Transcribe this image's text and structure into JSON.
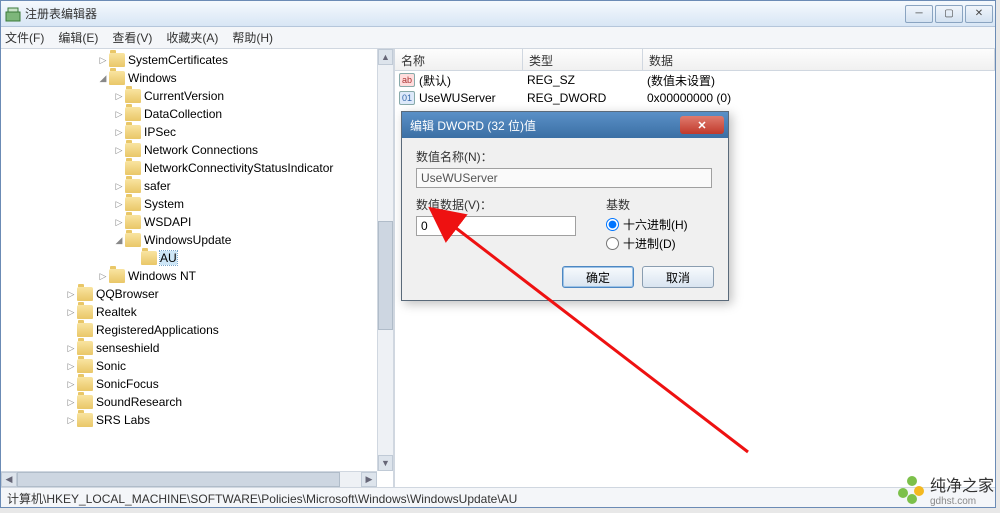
{
  "window": {
    "title": "注册表编辑器"
  },
  "win_controls": {
    "min": "─",
    "max": "▢",
    "close": "✕"
  },
  "menu": {
    "file": "文件(F)",
    "edit": "编辑(E)",
    "view": "查看(V)",
    "fav": "收藏夹(A)",
    "help": "帮助(H)"
  },
  "tree": {
    "items": [
      {
        "indent": 6,
        "tw": "▷",
        "label": "SystemCertificates"
      },
      {
        "indent": 6,
        "tw": "◢",
        "label": "Windows"
      },
      {
        "indent": 7,
        "tw": "▷",
        "label": "CurrentVersion"
      },
      {
        "indent": 7,
        "tw": "▷",
        "label": "DataCollection"
      },
      {
        "indent": 7,
        "tw": "▷",
        "label": "IPSec"
      },
      {
        "indent": 7,
        "tw": "▷",
        "label": "Network Connections"
      },
      {
        "indent": 7,
        "tw": "",
        "label": "NetworkConnectivityStatusIndicator"
      },
      {
        "indent": 7,
        "tw": "▷",
        "label": "safer"
      },
      {
        "indent": 7,
        "tw": "▷",
        "label": "System"
      },
      {
        "indent": 7,
        "tw": "▷",
        "label": "WSDAPI"
      },
      {
        "indent": 7,
        "tw": "◢",
        "label": "WindowsUpdate"
      },
      {
        "indent": 8,
        "tw": "",
        "label": "AU",
        "selected": true
      },
      {
        "indent": 6,
        "tw": "▷",
        "label": "Windows NT"
      },
      {
        "indent": 4,
        "tw": "▷",
        "label": "QQBrowser"
      },
      {
        "indent": 4,
        "tw": "▷",
        "label": "Realtek"
      },
      {
        "indent": 4,
        "tw": "",
        "label": "RegisteredApplications"
      },
      {
        "indent": 4,
        "tw": "▷",
        "label": "senseshield"
      },
      {
        "indent": 4,
        "tw": "▷",
        "label": "Sonic"
      },
      {
        "indent": 4,
        "tw": "▷",
        "label": "SonicFocus"
      },
      {
        "indent": 4,
        "tw": "▷",
        "label": "SoundResearch"
      },
      {
        "indent": 4,
        "tw": "▷",
        "label": "SRS Labs"
      }
    ]
  },
  "list": {
    "columns": {
      "name": "名称",
      "type": "类型",
      "data": "数据"
    },
    "rows": [
      {
        "icon": "str",
        "name": "(默认)",
        "type": "REG_SZ",
        "data": "(数值未设置)"
      },
      {
        "icon": "dw",
        "name": "UseWUServer",
        "type": "REG_DWORD",
        "data": "0x00000000 (0)"
      }
    ]
  },
  "dialog": {
    "title": "编辑 DWORD (32 位)值",
    "name_label": "数值名称(N)：",
    "name_value": "UseWUServer",
    "data_label": "数值数据(V)：",
    "data_value": "0",
    "base_label": "基数",
    "radix_hex": "十六进制(H)",
    "radix_dec": "十进制(D)",
    "ok": "确定",
    "cancel": "取消"
  },
  "statusbar": {
    "path": "计算机\\HKEY_LOCAL_MACHINE\\SOFTWARE\\Policies\\Microsoft\\Windows\\WindowsUpdate\\AU"
  },
  "watermark": {
    "brand": "纯净之家",
    "url": "gdhst.com"
  }
}
